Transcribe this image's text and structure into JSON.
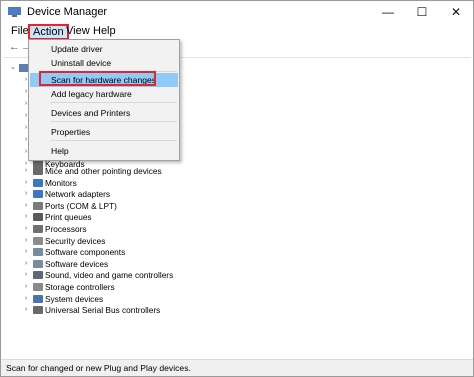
{
  "window": {
    "title": "Device Manager",
    "min_glyph": "—",
    "max_glyph": "☐",
    "close_glyph": "✕"
  },
  "menubar": {
    "file": "File",
    "action": "Action",
    "view": "View",
    "help": "Help"
  },
  "toolbar": {
    "back_glyph": "←",
    "forward_glyph": "→"
  },
  "action_menu": {
    "update_driver": "Update driver",
    "uninstall_device": "Uninstall device",
    "scan": "Scan for hardware changes",
    "add_legacy": "Add legacy hardware",
    "devices_printers": "Devices and Printers",
    "properties": "Properties",
    "help": "Help"
  },
  "tree": {
    "partial_row": "Keyboards",
    "items": [
      {
        "label": "Mice and other pointing devices",
        "icon": "mouse-icon",
        "color": "#6a6a6a"
      },
      {
        "label": "Monitors",
        "icon": "monitor-icon",
        "color": "#3b78c4"
      },
      {
        "label": "Network adapters",
        "icon": "network-adapter-icon",
        "color": "#3b78c4"
      },
      {
        "label": "Ports (COM & LPT)",
        "icon": "port-icon",
        "color": "#7a7a7a"
      },
      {
        "label": "Print queues",
        "icon": "printer-icon",
        "color": "#5a5a5a"
      },
      {
        "label": "Processors",
        "icon": "processor-icon",
        "color": "#6f6f6f"
      },
      {
        "label": "Security devices",
        "icon": "security-icon",
        "color": "#8c8c8c"
      },
      {
        "label": "Software components",
        "icon": "software-component-icon",
        "color": "#7a8c9c"
      },
      {
        "label": "Software devices",
        "icon": "software-device-icon",
        "color": "#7a8c9c"
      },
      {
        "label": "Sound, video and game controllers",
        "icon": "speaker-icon",
        "color": "#5c6a7a"
      },
      {
        "label": "Storage controllers",
        "icon": "storage-icon",
        "color": "#8a8a8a"
      },
      {
        "label": "System devices",
        "icon": "system-device-icon",
        "color": "#4a74b0"
      },
      {
        "label": "Universal Serial Bus controllers",
        "icon": "usb-icon",
        "color": "#6a6a6a"
      }
    ]
  },
  "status": {
    "text": "Scan for changed or new Plug and Play devices."
  },
  "colors": {
    "menu_highlight": "#91c9f7",
    "annotation_red": "#e8232d"
  }
}
